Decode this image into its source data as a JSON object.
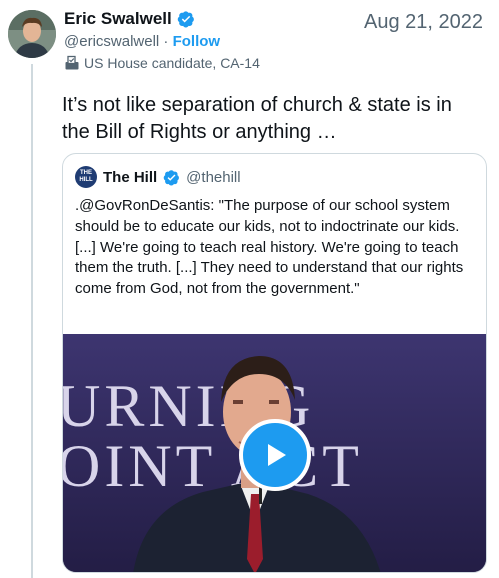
{
  "author": {
    "name": "Eric Swalwell",
    "handle": "@ericswalwell",
    "separator": " · ",
    "follow_label": "Follow",
    "label": "US House candidate, CA-14",
    "label_icon": "ballot-box-icon",
    "verified_icon": "verified-badge-icon"
  },
  "date": "Aug 21, 2022",
  "tweet_text": "It’s not like separation of church & state is in the Bill of Rights or anything …",
  "quote": {
    "logo_text": "THE HILL",
    "name": "The Hill",
    "handle": "@thehill",
    "text": ".@GovRonDeSantis: \"The purpose of our school system should be to educate our kids, not to indoctrinate our kids. [...] We're going to teach real history. We're going to teach them the truth. [...] They need to understand that our rights come from God, not from the government.\"",
    "media": {
      "backdrop_text_top": "URNING",
      "backdrop_text_bottom": "OINT ACT",
      "play_icon": "play-icon"
    }
  },
  "colors": {
    "accent": "#1d9bf0",
    "text": "#0f1419",
    "secondary": "#536471",
    "border": "#cfd9de"
  }
}
